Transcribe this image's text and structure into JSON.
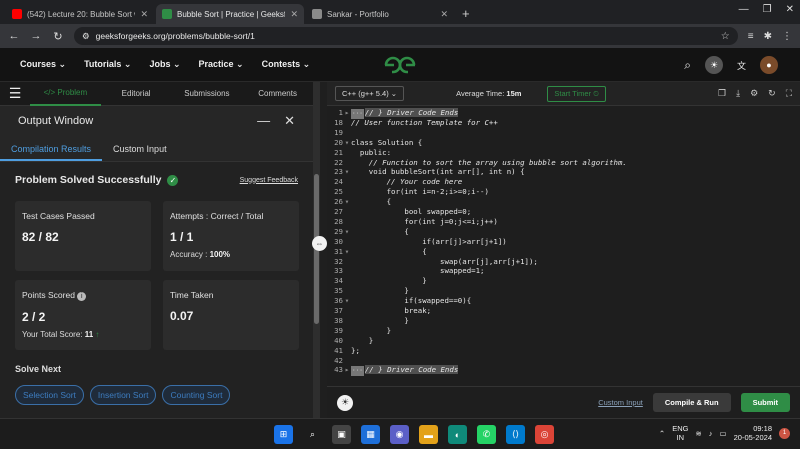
{
  "browser": {
    "tabs": [
      {
        "title": "(542) Lecture 20: Bubble Sort w",
        "fav_color": "#ff0000",
        "active": false
      },
      {
        "title": "Bubble Sort | Practice | Geeksfo",
        "fav_color": "#2f8d46",
        "active": true
      },
      {
        "title": "Sankar - Portfolio",
        "fav_color": "#8a8a8a",
        "active": false
      }
    ],
    "new_tab": "+",
    "url": "geeksforgeeks.org/problems/bubble-sort/1"
  },
  "gfg_header": {
    "menu": [
      "Courses ⌄",
      "Tutorials ⌄",
      "Jobs ⌄",
      "Practice ⌄",
      "Contests ⌄"
    ],
    "logo_text": "GG"
  },
  "problem_tabs": [
    "</> Problem",
    "Editorial",
    "Submissions",
    "Comments"
  ],
  "output_window": {
    "title": "Output Window",
    "subtabs": [
      "Compilation Results",
      "Custom Input"
    ],
    "status": "Problem Solved Successfully",
    "suggest_feedback": "Suggest Feedback",
    "cards": {
      "test_cases": {
        "label": "Test Cases Passed",
        "value": "82 / 82"
      },
      "attempts": {
        "label": "Attempts : Correct / Total",
        "value": "1 / 1",
        "sub_label": "Accuracy :",
        "sub_value": "100%"
      },
      "points": {
        "label": "Points Scored",
        "value": "2 / 2",
        "sub_label": "Your Total Score:",
        "sub_value": "11"
      },
      "time": {
        "label": "Time Taken",
        "value": "0.07"
      }
    },
    "solve_next": "Solve Next",
    "next_problems": [
      "Selection Sort",
      "Insertion Sort",
      "Counting Sort"
    ]
  },
  "editor": {
    "language": "C++ (g++ 5.4) ⌄",
    "avg_label": "Average Time:",
    "avg_value": "15m",
    "start_timer": "Start Timer ⏲",
    "lines": [
      {
        "n": "1",
        "fold": "▸",
        "text": "// } Driver Code Ends",
        "kind": "cmt",
        "tag": true,
        "hl": true
      },
      {
        "n": "18",
        "fold": "",
        "text": "// User function Template for C++",
        "kind": "cmt"
      },
      {
        "n": "19",
        "fold": "",
        "text": "",
        "kind": "plain"
      },
      {
        "n": "20",
        "fold": "▾",
        "text": "class Solution {",
        "kind": "plain"
      },
      {
        "n": "21",
        "fold": "",
        "text": "  public:",
        "kind": "kw"
      },
      {
        "n": "22",
        "fold": "",
        "text": "    // Function to sort the array using bubble sort algorithm.",
        "kind": "cmt"
      },
      {
        "n": "23",
        "fold": "▾",
        "text": "    void bubbleSort(int arr[], int n) {",
        "kind": "plain"
      },
      {
        "n": "24",
        "fold": "",
        "text": "        // Your code here",
        "kind": "cmt"
      },
      {
        "n": "25",
        "fold": "",
        "text": "        for(int i=n-2;i>=0;i--)",
        "kind": "kw"
      },
      {
        "n": "26",
        "fold": "▾",
        "text": "        {",
        "kind": "plain"
      },
      {
        "n": "27",
        "fold": "",
        "text": "            bool swapped=0;",
        "kind": "kw"
      },
      {
        "n": "28",
        "fold": "",
        "text": "            for(int j=0;j<=i;j++)",
        "kind": "kw"
      },
      {
        "n": "29",
        "fold": "▾",
        "text": "            {",
        "kind": "plain"
      },
      {
        "n": "30",
        "fold": "",
        "text": "                if(arr[j]>arr[j+1])",
        "kind": "kw"
      },
      {
        "n": "31",
        "fold": "▾",
        "text": "                {",
        "kind": "plain"
      },
      {
        "n": "32",
        "fold": "",
        "text": "                    swap(arr[j],arr[j+1]);",
        "kind": "plain"
      },
      {
        "n": "33",
        "fold": "",
        "text": "                    swapped=1;",
        "kind": "plain"
      },
      {
        "n": "34",
        "fold": "",
        "text": "                }",
        "kind": "plain"
      },
      {
        "n": "35",
        "fold": "",
        "text": "            }",
        "kind": "plain"
      },
      {
        "n": "36",
        "fold": "▾",
        "text": "            if(swapped==0){",
        "kind": "kw"
      },
      {
        "n": "37",
        "fold": "",
        "text": "            break;",
        "kind": "kw"
      },
      {
        "n": "38",
        "fold": "",
        "text": "            }",
        "kind": "plain"
      },
      {
        "n": "39",
        "fold": "",
        "text": "        }",
        "kind": "plain"
      },
      {
        "n": "40",
        "fold": "",
        "text": "    }",
        "kind": "plain"
      },
      {
        "n": "41",
        "fold": "",
        "text": "};",
        "kind": "plain"
      },
      {
        "n": "42",
        "fold": "",
        "text": "",
        "kind": "plain"
      },
      {
        "n": "43",
        "fold": "▸",
        "text": "// } Driver Code Ends",
        "kind": "cmt",
        "tag": true,
        "hl": true
      }
    ],
    "custom_input": "Custom Input",
    "compile_run": "Compile & Run",
    "submit": "Submit"
  },
  "taskbar": {
    "lang_line1": "ENG",
    "lang_line2": "IN",
    "time": "09:18",
    "date": "20-05-2024"
  }
}
